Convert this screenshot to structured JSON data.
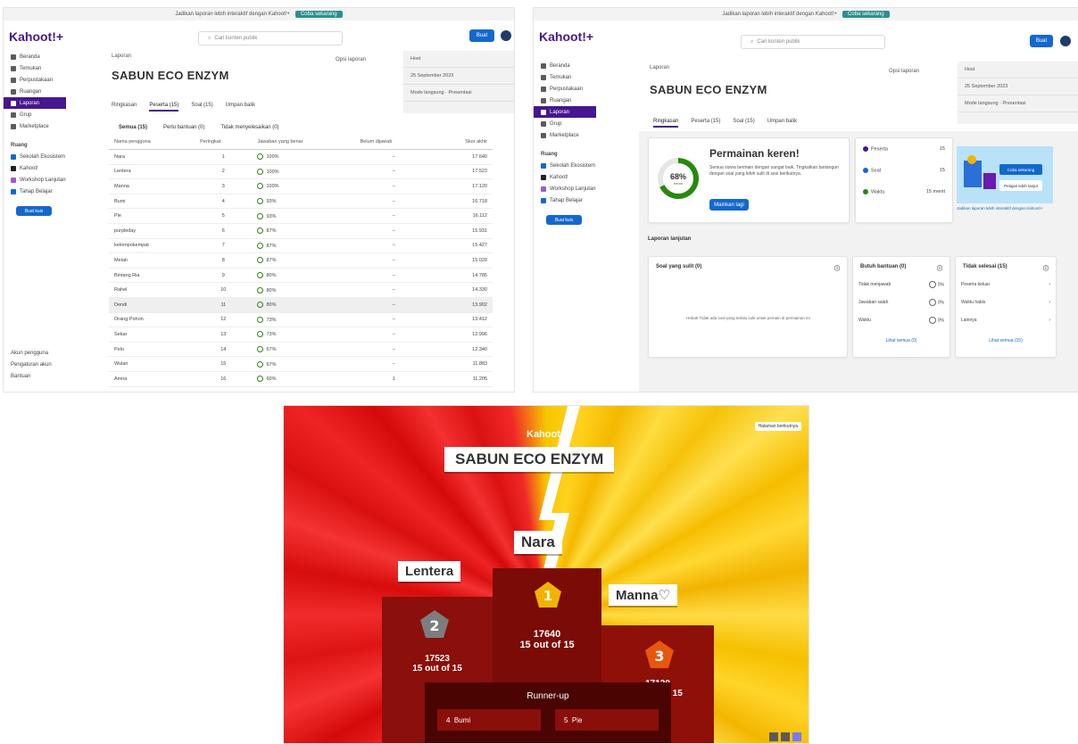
{
  "colors": {
    "purple": "#46178f",
    "blue": "#1368ce",
    "green": "#26890c",
    "gold": "#f2b300",
    "red": "#e01010"
  },
  "common": {
    "brand": "Kahoot!+",
    "search_placeholder": "Cari konten publik",
    "upgrade_label": "Buat",
    "report_title": "SABUN ECO ENZYM",
    "breadcrumb": "Laporan",
    "report_options": "Opsi laporan",
    "sidebar": [
      {
        "label": "Beranda",
        "icon": "home-icon"
      },
      {
        "label": "Temukan",
        "icon": "compass-icon"
      },
      {
        "label": "Perpustakaan",
        "icon": "library-icon"
      },
      {
        "label": "Ruangan",
        "icon": "room-icon"
      },
      {
        "label": "Laporan",
        "icon": "report-icon",
        "active": true
      },
      {
        "label": "Grup",
        "icon": "group-icon"
      },
      {
        "label": "Marketplace",
        "icon": "store-icon"
      }
    ],
    "workspace_label": "Ruang",
    "workspaces": [
      {
        "label": "Sekolah Ekosistem"
      },
      {
        "label": "Kahoot!"
      },
      {
        "label": "Workshop Lanjutan"
      },
      {
        "label": "Tahap Belajar"
      }
    ],
    "create_label": "Buat kuis",
    "footer_links": [
      "Akun pengguna",
      "Pengaturan akun",
      "Bantuan"
    ],
    "info": {
      "host": "Host",
      "date": "25 September 2023",
      "mode": "Mode langsung · Presentasi"
    },
    "tabs": [
      "Ringkasan",
      "Peserta (15)",
      "Soal (15)",
      "Umpan balik"
    ]
  },
  "panel_a": {
    "subtabs": [
      "Semua (15)",
      "Perlu bantuan (0)",
      "Tidak menyelesaikan (0)"
    ],
    "columns": [
      "Nama pengguna",
      "Peringkat",
      "Jawaban yang benar",
      "Belum dijawab",
      "Skor akhir"
    ],
    "rows": [
      {
        "name": "Nara",
        "rank": "1",
        "pct": "100%",
        "unanswered": "–",
        "score": "17.640"
      },
      {
        "name": "Lentera",
        "rank": "2",
        "pct": "100%",
        "unanswered": "–",
        "score": "17.523"
      },
      {
        "name": "Manna",
        "rank": "3",
        "pct": "100%",
        "unanswered": "–",
        "score": "17.120"
      },
      {
        "name": "Bumi",
        "rank": "4",
        "pct": "93%",
        "unanswered": "–",
        "score": "16.718"
      },
      {
        "name": "Pie",
        "rank": "5",
        "pct": "93%",
        "unanswered": "–",
        "score": "16.112"
      },
      {
        "name": "purpleday",
        "rank": "6",
        "pct": "87%",
        "unanswered": "–",
        "score": "15.931"
      },
      {
        "name": "kelompokempat",
        "rank": "7",
        "pct": "87%",
        "unanswered": "–",
        "score": "15.427"
      },
      {
        "name": "Melati",
        "rank": "8",
        "pct": "87%",
        "unanswered": "–",
        "score": "15.020"
      },
      {
        "name": "Bintang Ria",
        "rank": "9",
        "pct": "80%",
        "unanswered": "–",
        "score": "14.785"
      },
      {
        "name": "Rahel",
        "rank": "10",
        "pct": "80%",
        "unanswered": "–",
        "score": "14.330"
      },
      {
        "name": "Dendi",
        "rank": "11",
        "pct": "80%",
        "unanswered": "–",
        "score": "13.902",
        "highlight": true
      },
      {
        "name": "Orang Pohon",
        "rank": "12",
        "pct": "73%",
        "unanswered": "–",
        "score": "13.412"
      },
      {
        "name": "Sekar",
        "rank": "13",
        "pct": "73%",
        "unanswered": "–",
        "score": "12.996"
      },
      {
        "name": "Pelo",
        "rank": "14",
        "pct": "67%",
        "unanswered": "–",
        "score": "12.340"
      },
      {
        "name": "Wulan",
        "rank": "15",
        "pct": "67%",
        "unanswered": "–",
        "score": "11.883"
      },
      {
        "name": "Amira",
        "rank": "16",
        "pct": "60%",
        "unanswered": "1",
        "score": "11.205"
      }
    ]
  },
  "panel_b": {
    "summary_title": "Permainan keren!",
    "summary_text": "Semua siswa bermain dengan sangat baik. Tingkatkan tantangan dengan soal yang lebih sulit di sesi berikutnya.",
    "summary_button": "Mainkan lagi",
    "correct_pct": 68,
    "correct_label": "68%",
    "correct_sub": "benar",
    "stats": [
      {
        "label": "Peserta",
        "value": "15",
        "color": "#46178f"
      },
      {
        "label": "Soal",
        "value": "15",
        "color": "#1368ce"
      },
      {
        "label": "Waktu",
        "value": "15 menit",
        "color": "#26890c"
      }
    ],
    "promo_btn1": "Coba sekarang",
    "promo_btn2": "Pelajari lebih lanjut",
    "promo_caption": "Jadikan laporan lebih interaktif dengan Kahoot!+",
    "section_title": "Laporan lanjutan",
    "difficult": {
      "title": "Soal yang sulit (0)",
      "empty": "Hebat! Tidak ada soal yang terlalu sulit untuk pemain di permainan ini."
    },
    "help": {
      "title": "Butuh bantuan (0)",
      "rows": [
        {
          "label": "Tidak menjawab",
          "value": "0%"
        },
        {
          "label": "Jawaban salah",
          "value": "0%"
        },
        {
          "label": "Waktu",
          "value": "0%"
        }
      ],
      "link": "Lihat semua (0)"
    },
    "unfinished": {
      "title": "Tidak selesai (15)",
      "rows": [
        {
          "label": "Peserta keluar"
        },
        {
          "label": "Waktu habis"
        },
        {
          "label": "Lainnya"
        }
      ],
      "link": "Lihat semua (15)"
    }
  },
  "panel_c": {
    "brand": "Kahoot!",
    "quit_label": "Halaman berikutnya",
    "title": "SABUN ECO ENZYM",
    "first": {
      "name": "Nara",
      "rank": "1",
      "score": "17640",
      "correct": "15 out of 15"
    },
    "second": {
      "name": "Lentera",
      "rank": "2",
      "score": "17523",
      "correct": "15 out of 15"
    },
    "third": {
      "name": "Manna♡",
      "rank": "3",
      "score": "17120",
      "correct": "15 out of 15"
    },
    "runner_up_label": "Runner-up",
    "runner_ups": [
      {
        "rank": "4",
        "name": "Bumi"
      },
      {
        "rank": "5",
        "name": "Pie"
      }
    ]
  }
}
